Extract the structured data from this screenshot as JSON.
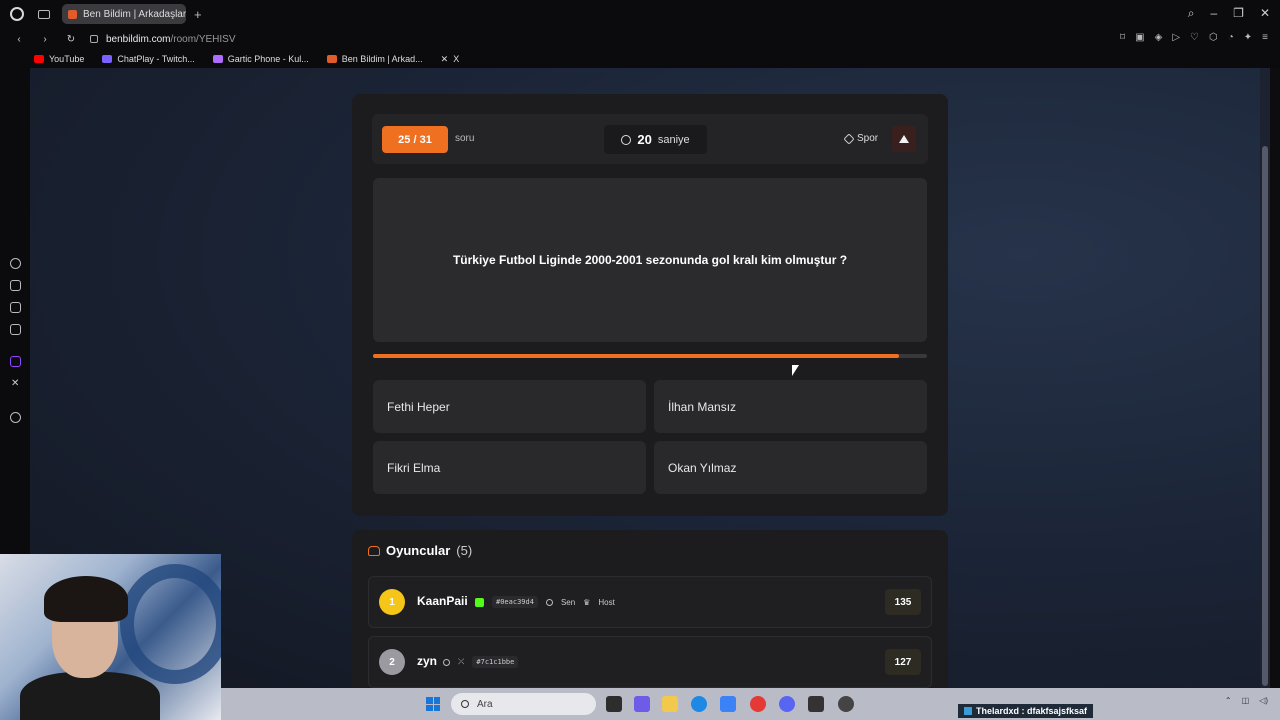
{
  "browser": {
    "tab_title": "Ben Bildim | Arkadaşlarınla",
    "url_host": "benbildim.com",
    "url_path": "/room/YEHISV",
    "bookmarks": [
      {
        "label": "YouTube",
        "color": "#ff0000"
      },
      {
        "label": "ChatPlay - Twitch...",
        "color": "#7b61ff"
      },
      {
        "label": "Gartic Phone - Kul...",
        "color": "#b06cff"
      },
      {
        "label": "Ben Bildim | Arkad...",
        "color": "#e25b2a"
      },
      {
        "label": "X",
        "color": "#ffffff"
      }
    ]
  },
  "quiz": {
    "counter": "25 / 31",
    "counter_label": "soru",
    "timer_value": "20",
    "timer_unit": "saniye",
    "category": "Spor",
    "question": "Türkiye Futbol Liginde 2000-2001 sezonunda gol kralı kim olmuştur ?",
    "progress_fraction": 0.95,
    "answers": [
      "Fethi Heper",
      "İlhan Mansız",
      "Fikri Elma",
      "Okan Yılmaz"
    ],
    "accent_color": "#f07021"
  },
  "players": {
    "title": "Oyuncular",
    "count": "(5)",
    "list": [
      {
        "rank": "1",
        "name": "KaanPaii",
        "id": "#0eac39d4",
        "you_label": "Sen",
        "host_label": "Host",
        "score": "135",
        "rank_color": "#f5c518"
      },
      {
        "rank": "2",
        "name": "zyn",
        "id": "#7c1c1bbe",
        "score": "127",
        "rank_color": "#9a9aa0"
      }
    ]
  },
  "taskbar": {
    "search_placeholder": "Ara",
    "ticker_text": "Thelardxd : dfakfsajsfksaf"
  }
}
